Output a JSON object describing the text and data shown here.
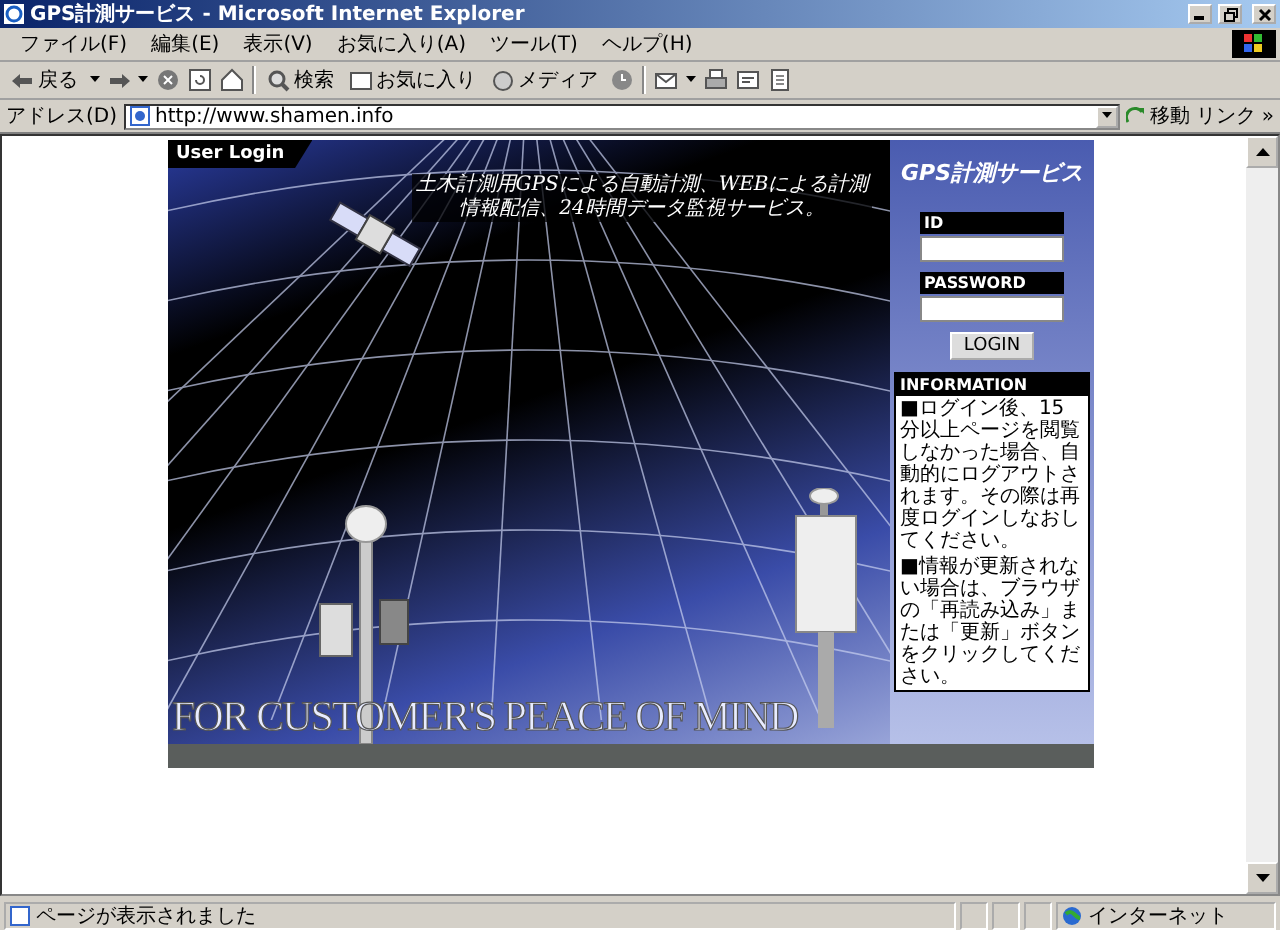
{
  "window": {
    "title": "GPS計測サービス - Microsoft Internet Explorer"
  },
  "menu": [
    "ファイル(F)",
    "編集(E)",
    "表示(V)",
    "お気に入り(A)",
    "ツール(T)",
    "ヘルプ(H)"
  ],
  "toolbar": {
    "back": "戻る",
    "search": "検索",
    "favorites": "お気に入り",
    "media": "メディア"
  },
  "address_bar": {
    "label": "アドレス(D)",
    "value": "http://www.shamen.info",
    "go": "移動",
    "links": "リンク",
    "more": "»"
  },
  "page": {
    "tag": "User Login",
    "tagline": "土木計測用GPSによる自動計測、WEBによる計測情報配信、24時間データ監視サービス。",
    "service_title": "GPS計測サービス",
    "login": {
      "id_label": "ID",
      "password_label": "PASSWORD",
      "button": "LOGIN"
    },
    "information": {
      "title": "INFORMATION",
      "paragraphs": [
        "■ログイン後、15分以上ページを閲覧しなかった場合、自動的にログアウトされます。その際は再度ログインしなおしてください。",
        "■情報が更新されない場合は、ブラウザの「再読み込み」または「更新」ボタンをクリックしてください。"
      ]
    },
    "slogan": "FOR CUSTOMER'S PEACE OF MIND"
  },
  "status_bar": {
    "text": "ページが表示されました",
    "zone": "インターネット"
  }
}
